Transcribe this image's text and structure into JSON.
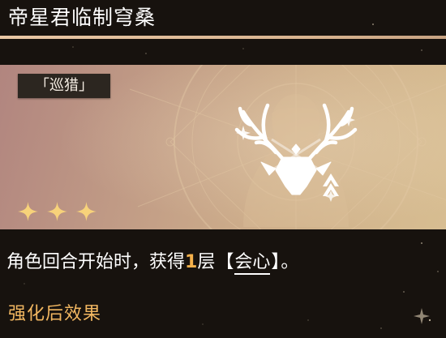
{
  "title": "帝星君临制穹桑",
  "path_tag": "「巡猎」",
  "rarity_stars": 3,
  "description": {
    "before": "角色回合开始时，获得",
    "highlight_number": "1",
    "after_number": "层",
    "open_bracket": "【",
    "keyword": "会心",
    "close_bracket": "】",
    "end": "。"
  },
  "enhanced_section_title": "强化后效果",
  "icons": {
    "path_emblem": "stag-antler-emblem-icon",
    "rank_marker": "chevron-up-icon",
    "star": "sparkle-star-icon"
  },
  "colors": {
    "background": "#17120e",
    "title_rule": "#e9c7a5",
    "highlight": "#f5b14b",
    "section_title": "#f2b761",
    "star": "#f7d27a"
  }
}
